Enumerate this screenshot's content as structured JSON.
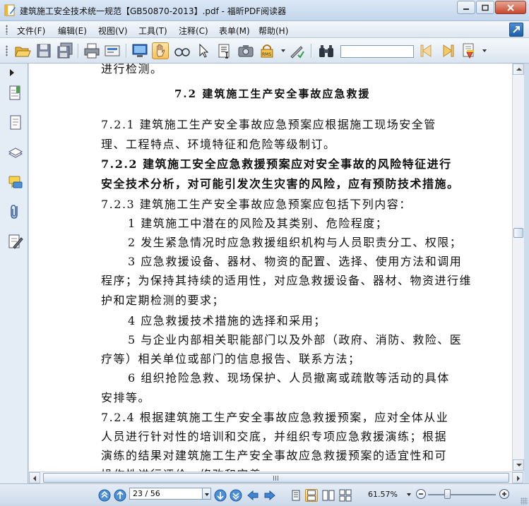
{
  "window": {
    "title": "建筑施工安全技术统一规范【GB50870-2013】.pdf - 福昕PDF阅读器"
  },
  "menu": [
    {
      "label": "文件(F)"
    },
    {
      "label": "编辑(E)"
    },
    {
      "label": "视图(V)"
    },
    {
      "label": "工具(T)"
    },
    {
      "label": "注释(C)"
    },
    {
      "label": "表单(M)"
    },
    {
      "label": "帮助(H)"
    }
  ],
  "toolbar": {
    "search_value": "",
    "icons": [
      "open-folder-icon",
      "save-icon",
      "save-all-icon",
      "print-icon",
      "scan-icon",
      "fullscreen-icon",
      "hand-tool-icon",
      "zoom-glasses-icon",
      "select-arrow-icon",
      "text-select-icon",
      "snapshot-icon",
      "rms-lock-icon",
      "sign-icon",
      "find-binoculars-icon",
      "prev-result-icon",
      "next-result-icon",
      "highlight-icon"
    ]
  },
  "document": {
    "top_fragment": "进行检测。",
    "section_title": "7.2  建筑施工生产安全事故应急救援",
    "lines": [
      {
        "text": "7.2.1  建筑施工生产安全事故应急预案应根据施工现场安全管",
        "bold": false
      },
      {
        "text": "理、工程特点、环境特征和危险等级制订。",
        "bold": false
      },
      {
        "text": "7.2.2  建筑施工安全应急救援预案应对安全事故的风险特征进行",
        "bold": true
      },
      {
        "text": "安全技术分析，对可能引发次生灾害的风险，应有预防技术措施。",
        "bold": true
      },
      {
        "text": "7.2.3  建筑施工生产安全事故应急预案应包括下列内容：",
        "bold": false
      },
      {
        "text": "1  建筑施工中潜在的风险及其类别、危险程度；",
        "bold": false
      },
      {
        "text": "2  发生紧急情况时应急救援组织机构与人员职责分工、权限；",
        "bold": false
      },
      {
        "text": "3  应急救援设备、器材、物资的配置、选择、使用方法和调用",
        "bold": false
      },
      {
        "text": "程序；为保持其持续的适用性，对应急救援设备、器材、物资进行维",
        "bold": false
      },
      {
        "text": "护和定期检测的要求；",
        "bold": false
      },
      {
        "text": "4  应急救援技术措施的选择和采用；",
        "bold": false
      },
      {
        "text": "5  与企业内部相关职能部门以及外部（政府、消防、救险、医",
        "bold": false
      },
      {
        "text": "疗等）相关单位或部门的信息报告、联系方法；",
        "bold": false
      },
      {
        "text": "6  组织抢险急救、现场保护、人员撤离或疏散等活动的具体",
        "bold": false
      },
      {
        "text": "安排等。",
        "bold": false
      },
      {
        "text": "7.2.4  根据建筑施工生产安全事故应急救援预案，应对全体从业",
        "bold": false
      },
      {
        "text": "人员进行针对性的培训和交底，并组织专项应急救援演练；根据",
        "bold": false
      },
      {
        "text": "演练的结果对建筑施工生产安全事故应急救援预案的适宜性和可",
        "bold": false
      },
      {
        "text": "操作性进行评价，修改和完善。",
        "bold": false
      }
    ]
  },
  "statusbar": {
    "page_value": "23 / 56",
    "zoom": "61.57%"
  },
  "colors": {
    "titlebar": "#c4d6ec",
    "accent": "#1f5ea8",
    "page_bg": "#ffffff"
  }
}
